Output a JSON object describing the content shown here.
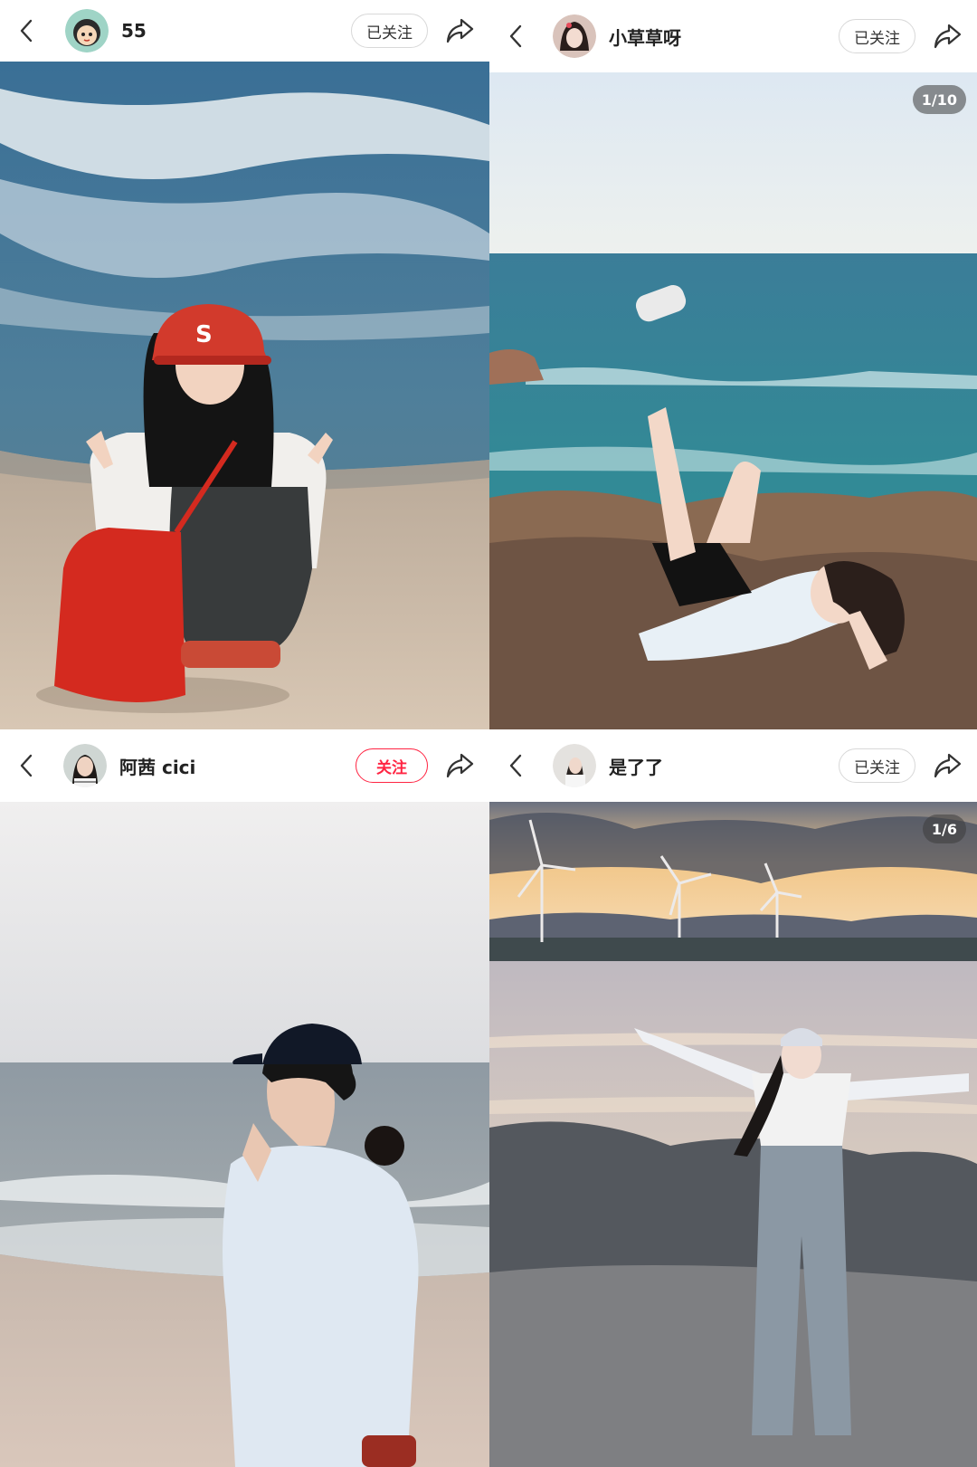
{
  "posts": [
    {
      "username": "55",
      "follow_label": "已关注",
      "avatar_icon": "cartoon-avatar",
      "photo": "girl in red cap crouching on beach making peace signs"
    },
    {
      "username": "小草草呀",
      "follow_label": "已关注",
      "avatar_icon": "girl-avatar",
      "counter": "1/10",
      "photo": "girl lying on seaside rocks with leg raised"
    },
    {
      "username": "阿茜 cici",
      "follow_label": "关注",
      "avatar_icon": "girl-avatar",
      "photo": "woman in black cap and light blue shirt on beach"
    },
    {
      "username": "是了了",
      "follow_label": "已关注",
      "avatar_icon": "girl-avatar",
      "counter": "1/6",
      "photo": "girl with arms outstretched by wind turbines at sunset"
    }
  ],
  "colors": {
    "accent": "#ff2442",
    "border": "#d8d8d8",
    "text": "#222222"
  }
}
